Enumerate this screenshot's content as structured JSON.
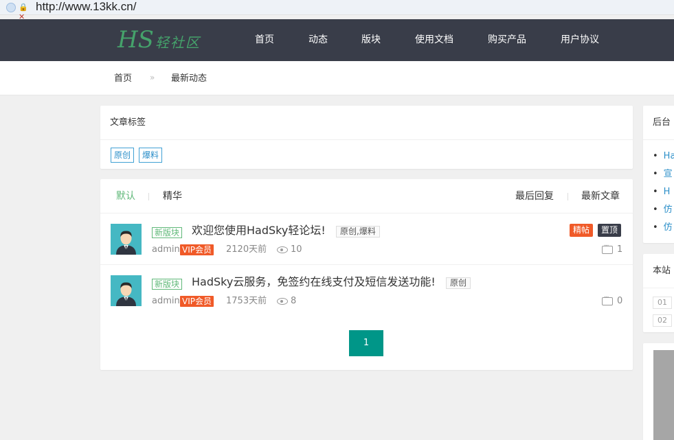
{
  "browser": {
    "url": "http://www.13kk.cn/"
  },
  "site": {
    "logo_main": "HS",
    "logo_sub": "轻社区"
  },
  "nav": [
    "首页",
    "动态",
    "版块",
    "使用文档",
    "购买产品",
    "用户协议"
  ],
  "breadcrumb": {
    "home": "首页",
    "sep": "»",
    "current": "最新动态"
  },
  "tags_card": {
    "title": "文章标签",
    "tags": [
      "原创",
      "爆料"
    ]
  },
  "list": {
    "tabs_left": [
      "默认",
      "精华"
    ],
    "tabs_right": [
      "最后回复",
      "最新文章"
    ],
    "posts": [
      {
        "board": "新版块",
        "title": "欢迎您使用HadSky轻论坛!",
        "tags": "原创,爆料",
        "user": "admin",
        "vip": "VIP会员",
        "time": "2120天前",
        "views": "10",
        "comments": "1",
        "flags": [
          "精帖",
          "置顶"
        ]
      },
      {
        "board": "新版块",
        "title": "HadSky云服务，免签约在线支付及短信发送功能!",
        "tags": "原创",
        "user": "admin",
        "vip": "VIP会员",
        "time": "1753天前",
        "views": "8",
        "comments": "0",
        "flags": []
      }
    ],
    "page": "1"
  },
  "sidebar": {
    "card1_title": "后台",
    "card1_links": [
      "Ha",
      "宣",
      "H",
      "仿",
      "仿"
    ],
    "card2_title": "本站",
    "ranks": [
      "01",
      "02"
    ]
  },
  "colors": {
    "nav_bg": "#393d49",
    "accent_green": "#5fb878",
    "page_btn": "#009688",
    "vip": "#f05a28"
  }
}
